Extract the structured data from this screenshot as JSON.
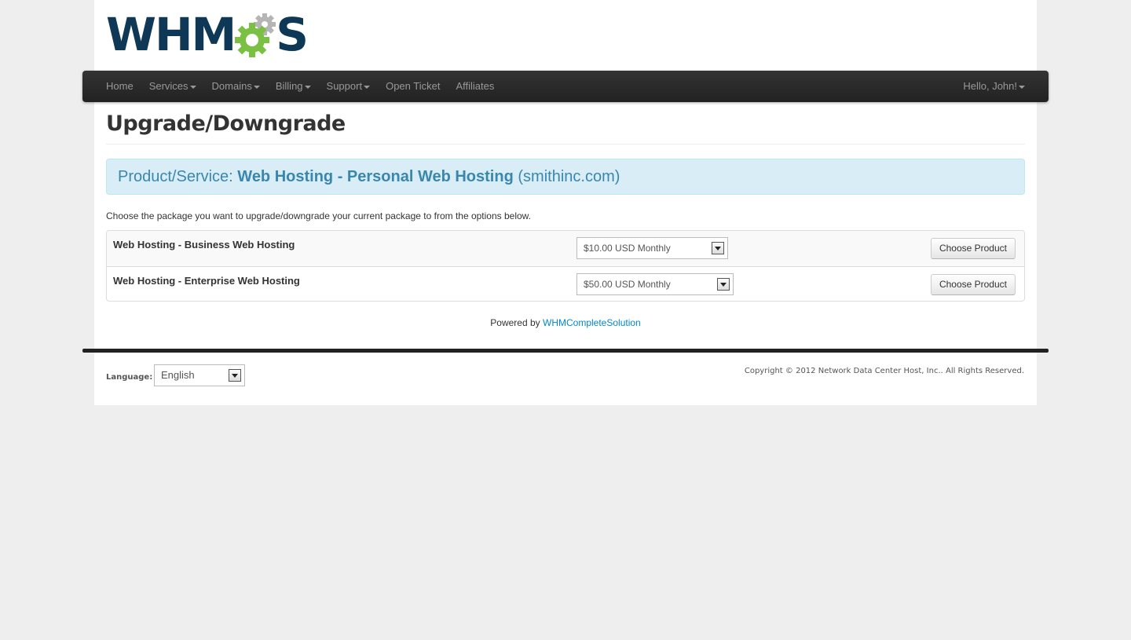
{
  "brand": {
    "logo_text_left": "WHM",
    "logo_text_right": "S",
    "logo_icon": "gear-icon",
    "colors": {
      "logo_dark": "#0e3856",
      "gear_green": "#7ac143",
      "gear_gray": "#b5b5b5"
    }
  },
  "navbar": {
    "items": [
      {
        "label": "Home",
        "dropdown": false
      },
      {
        "label": "Services",
        "dropdown": true
      },
      {
        "label": "Domains",
        "dropdown": true
      },
      {
        "label": "Billing",
        "dropdown": true
      },
      {
        "label": "Support",
        "dropdown": true
      },
      {
        "label": "Open Ticket",
        "dropdown": false
      },
      {
        "label": "Affiliates",
        "dropdown": false
      }
    ],
    "user_menu": "Hello, John!"
  },
  "page": {
    "title": "Upgrade/Downgrade",
    "product_label": "Product/Service:",
    "product_name": "Web Hosting - Personal Web Hosting",
    "product_domain": "(smithinc.com)",
    "intro": "Choose the package you want to upgrade/downgrade your current package to from the options below."
  },
  "packages": [
    {
      "name": "Web Hosting - Business Web Hosting",
      "price_option": "$10.00 USD Monthly",
      "button": "Choose Product"
    },
    {
      "name": "Web Hosting - Enterprise Web Hosting",
      "price_option": "$50.00 USD Monthly",
      "button": "Choose Product"
    }
  ],
  "powered": {
    "prefix": "Powered by",
    "link": "WHMCompleteSolution"
  },
  "footer": {
    "language_label": "Language:",
    "language_value": "English",
    "copyright": "Copyright © 2012 Network Data Center Host, Inc.. All Rights Reserved."
  },
  "colors": {
    "navbar_bg": "#222222",
    "nav_text": "#999999",
    "info_bg": "#d9edf7",
    "info_text": "#3a87ad",
    "link": "#0088cc",
    "page_bg": "#eeeeee"
  }
}
